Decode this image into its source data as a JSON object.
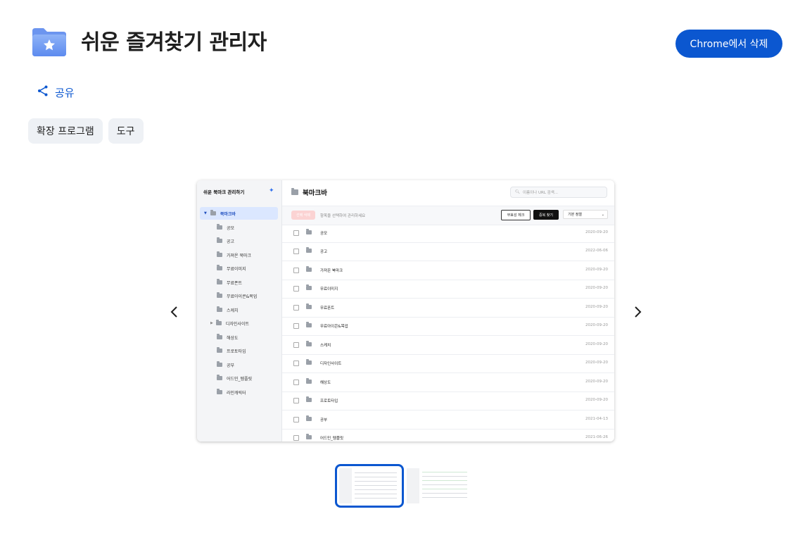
{
  "app": {
    "title": "쉬운 즐겨찾기 관리자",
    "remove_label": "Chrome에서 삭제",
    "share_label": "공유",
    "accent_color": "#0b57d0"
  },
  "chips": [
    "확장 프로그램",
    "도구"
  ],
  "screenshot": {
    "sidebar_title": "쉬운 북마크 관리하기",
    "tree": [
      {
        "label": "북마크바",
        "selected": true
      },
      {
        "label": "공모"
      },
      {
        "label": "공고"
      },
      {
        "label": "가져온 북마크"
      },
      {
        "label": "무료이미지"
      },
      {
        "label": "무료폰트"
      },
      {
        "label": "무료아이콘&목업"
      },
      {
        "label": "스케치"
      },
      {
        "label": "디자인사이트"
      },
      {
        "label": "해상도"
      },
      {
        "label": "프로토타입"
      },
      {
        "label": "공부"
      },
      {
        "label": "어드민_템플릿"
      },
      {
        "label": "라인캐릭터"
      }
    ],
    "main_title": "북마크바",
    "search_placeholder": "이름이나 URL 검색...",
    "delete_label": "선택 삭제",
    "hint": "항목을 선택하여 관리하세요",
    "check_dead_label": "무효성 체크",
    "find_dupes_label": "중복 찾기",
    "sort_label": "기본 정렬",
    "rows": [
      {
        "name": "공모",
        "date": "2020-09-20"
      },
      {
        "name": "공고",
        "date": "2022-06-06"
      },
      {
        "name": "가져온 북마크",
        "date": "2020-09-20"
      },
      {
        "name": "무료이미지",
        "date": "2020-09-20"
      },
      {
        "name": "무료폰트",
        "date": "2020-09-20"
      },
      {
        "name": "무료아이콘&목업",
        "date": "2020-09-20"
      },
      {
        "name": "스케치",
        "date": "2020-09-20"
      },
      {
        "name": "디자인사이트",
        "date": "2020-09-20"
      },
      {
        "name": "해상도",
        "date": "2020-09-20"
      },
      {
        "name": "프로토타입",
        "date": "2020-09-20"
      },
      {
        "name": "공부",
        "date": "2021-04-13"
      },
      {
        "name": "어드민_템플릿",
        "date": "2021-06-26"
      }
    ]
  }
}
